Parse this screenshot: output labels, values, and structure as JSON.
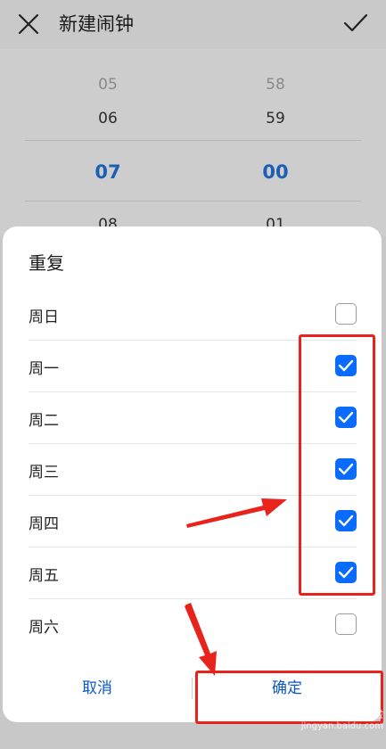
{
  "appbar": {
    "title": "新建闹钟",
    "close_icon": "close-icon",
    "confirm_icon": "check-icon"
  },
  "time_picker": {
    "hours": {
      "far": "05",
      "near": "06",
      "selected": "07",
      "next": "08"
    },
    "minutes": {
      "far": "58",
      "near": "59",
      "selected": "00",
      "next": "01"
    }
  },
  "dialog": {
    "title": "重复",
    "days": [
      {
        "label": "周日",
        "checked": false
      },
      {
        "label": "周一",
        "checked": true
      },
      {
        "label": "周二",
        "checked": true
      },
      {
        "label": "周三",
        "checked": true
      },
      {
        "label": "周四",
        "checked": true
      },
      {
        "label": "周五",
        "checked": true
      },
      {
        "label": "周六",
        "checked": false
      }
    ],
    "cancel_label": "取消",
    "ok_label": "确定"
  },
  "colors": {
    "accent": "#0a6cff",
    "link": "#0a59c7",
    "annotation": "#e8231b"
  },
  "watermark": {
    "brand": "Baidu经验",
    "site": "jingyan.baidu.com"
  }
}
